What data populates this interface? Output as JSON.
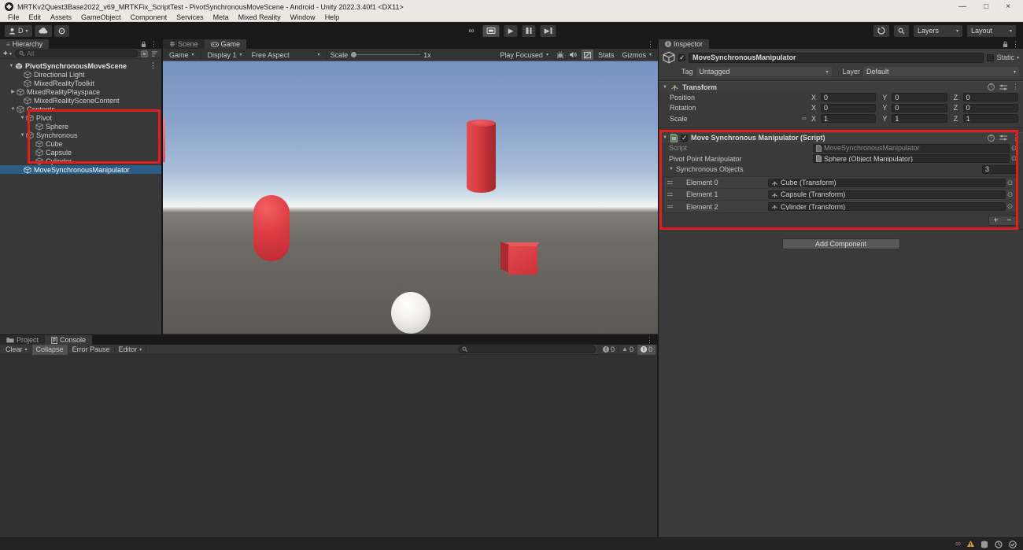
{
  "window": {
    "title": "MRTKv2Quest3Base2022_v69_MRTKFix_ScriptTest - PivotSynchronousMoveScene - Android - Unity 2022.3.40f1 <DX11>",
    "minimize": "—",
    "maximize": "□",
    "close": "×"
  },
  "menus": [
    "File",
    "Edit",
    "Assets",
    "GameObject",
    "Component",
    "Services",
    "Meta",
    "Mixed Reality",
    "Window",
    "Help"
  ],
  "toolbar": {
    "account": "D",
    "layers": "Layers",
    "layout": "Layout"
  },
  "tabs": {
    "scene": "Scene",
    "game": "Game",
    "hierarchy": "Hierarchy",
    "inspector": "Inspector",
    "project": "Project",
    "console": "Console"
  },
  "game_toolbar": {
    "target": "Game",
    "display": "Display 1",
    "aspect": "Free Aspect",
    "scale_label": "Scale",
    "scale_value": "1x",
    "focus": "Play Focused",
    "stats": "Stats",
    "gizmos": "Gizmos"
  },
  "hierarchy": {
    "search_placeholder": "All",
    "items": [
      {
        "label": "PivotSynchronousMoveScene",
        "arrow": "▼"
      },
      {
        "label": "Directional Light"
      },
      {
        "label": "MixedRealityToolkit"
      },
      {
        "label": "MixedRealityPlayspace",
        "arrow": "▶"
      },
      {
        "label": "MixedRealitySceneContent"
      },
      {
        "label": "Contents",
        "arrow": "▼"
      },
      {
        "label": "Pivot",
        "arrow": "▼"
      },
      {
        "label": "Sphere"
      },
      {
        "label": "Synchronous",
        "arrow": "▼"
      },
      {
        "label": "Cube"
      },
      {
        "label": "Capsule"
      },
      {
        "label": "Cylinder"
      },
      {
        "label": "MoveSynchronousManipulator"
      }
    ]
  },
  "inspector": {
    "name": "MoveSynchronousManipulator",
    "static_label": "Static",
    "tag_label": "Tag",
    "tag_value": "Untagged",
    "layer_label": "Layer",
    "layer_value": "Default",
    "transform": {
      "title": "Transform",
      "axis_x": "X",
      "axis_y": "Y",
      "axis_z": "Z",
      "rows": [
        {
          "label": "Position",
          "x": "0",
          "y": "0",
          "z": "0"
        },
        {
          "label": "Rotation",
          "x": "0",
          "y": "0",
          "z": "0"
        },
        {
          "label": "Scale",
          "x": "1",
          "y": "1",
          "z": "1"
        }
      ]
    },
    "script": {
      "title": "Move Synchronous Manipulator (Script)",
      "script_label": "Script",
      "script_value": "MoveSynchronousManipulator",
      "pivot_label": "Pivot Point Manipulator",
      "pivot_value": "Sphere (Object Manipulator)",
      "array_label": "Synchronous Objects",
      "array_size": "3",
      "elements": [
        {
          "label": "Element 0",
          "value": "Cube (Transform)"
        },
        {
          "label": "Element 1",
          "value": "Capsule (Transform)"
        },
        {
          "label": "Element 2",
          "value": "Cylinder (Transform)"
        }
      ],
      "add": "+",
      "remove": "−"
    },
    "add_component": "Add Component"
  },
  "console": {
    "clear": "Clear",
    "collapse": "Collapse",
    "error_pause": "Error Pause",
    "editor": "Editor",
    "info_count": "0",
    "warn_count": "0",
    "error_count": "0"
  },
  "colors": {
    "annotation_red": "#e21d1d",
    "selection_blue": "#2c5d87",
    "object_red": "#d63a3f"
  }
}
